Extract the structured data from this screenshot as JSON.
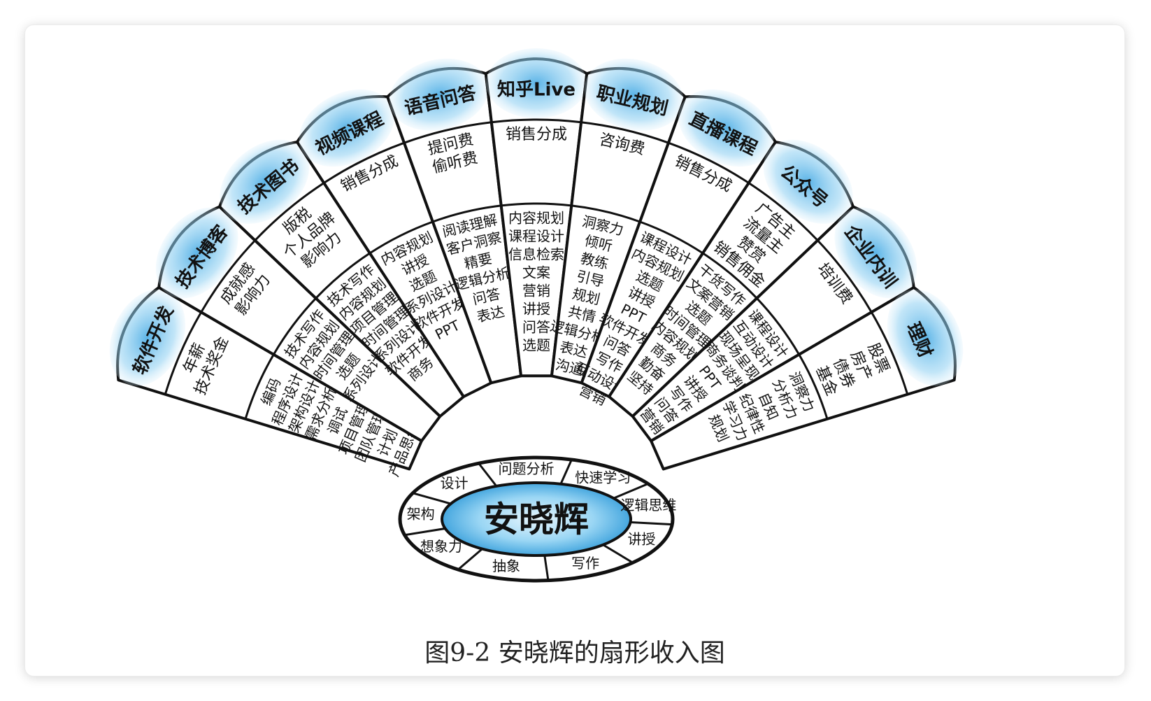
{
  "caption": "图9-2  安晓辉的扇形收入图",
  "center": {
    "name": "安晓辉",
    "skills": [
      "问题分析",
      "快速学习",
      "逻辑思维",
      "讲授",
      "写作",
      "抽象",
      "想象力",
      "架构",
      "设计"
    ]
  },
  "ribs": [
    {
      "title": "软件开发",
      "income": [
        "年薪",
        "技术奖金"
      ],
      "abilities": [
        "编码",
        "程序设计",
        "架构设计",
        "需求分析",
        "调试",
        "项目管理",
        "团队管理",
        "计划",
        "产品思维"
      ]
    },
    {
      "title": "技术博客",
      "income": [
        "成就感",
        "影响力"
      ],
      "abilities": [
        "技术写作",
        "内容规划",
        "时间管理",
        "选题",
        "系列设计"
      ]
    },
    {
      "title": "技术图书",
      "income": [
        "版税",
        "个人品牌",
        "影响力"
      ],
      "abilities": [
        "技术写作",
        "内容规划",
        "项目管理",
        "时间管理",
        "系列设计",
        "软件开发",
        "商务"
      ]
    },
    {
      "title": "视频课程",
      "income": [
        "销售分成"
      ],
      "abilities": [
        "内容规划",
        "讲授",
        "选题",
        "系列设计",
        "软件开发",
        "PPT"
      ]
    },
    {
      "title": "语音问答",
      "income": [
        "提问费",
        "偷听费"
      ],
      "abilities": [
        "阅读理解",
        "客户洞察",
        "精要",
        "逻辑分析",
        "问答",
        "表达"
      ]
    },
    {
      "title": "知乎Live",
      "income": [
        "销售分成"
      ],
      "abilities": [
        "内容规划",
        "课程设计",
        "信息检索",
        "文案",
        "营销",
        "讲授",
        "问答",
        "选题"
      ]
    },
    {
      "title": "职业规划",
      "income": [
        "咨询费"
      ],
      "abilities": [
        "洞察力",
        "倾听",
        "教练",
        "引导",
        "规划",
        "共情",
        "逻辑分析",
        "表达",
        "沟通"
      ]
    },
    {
      "title": "直播课程",
      "income": [
        "销售分成"
      ],
      "abilities": [
        "课程设计",
        "内容规划",
        "选题",
        "讲授",
        "PPT",
        "软件开发",
        "问答",
        "写作",
        "互动设计",
        "营销"
      ]
    },
    {
      "title": "公众号",
      "income": [
        "广告主",
        "流量主",
        "赞赏",
        "销售佣金"
      ],
      "abilities": [
        "干货写作",
        "文案营销",
        "选题",
        "时间管理",
        "内容规划",
        "商务",
        "勤奋",
        "坚持"
      ]
    },
    {
      "title": "企业内训",
      "income": [
        "培训费"
      ],
      "abilities": [
        "课程设计",
        "互动设计",
        "现场呈现",
        "商务谈判",
        "PPT",
        "讲授",
        "写作",
        "问答",
        "营销"
      ]
    },
    {
      "title": "理财",
      "income": [
        "股票",
        "房产",
        "债券",
        "基金"
      ],
      "abilities": [
        "洞察力",
        "分析力",
        "自知",
        "纪律性",
        "学习力",
        "规划"
      ]
    }
  ],
  "colors": {
    "accent_blue": "#3fa7e3",
    "light_blue": "#d6eefb",
    "ink": "#111111"
  }
}
